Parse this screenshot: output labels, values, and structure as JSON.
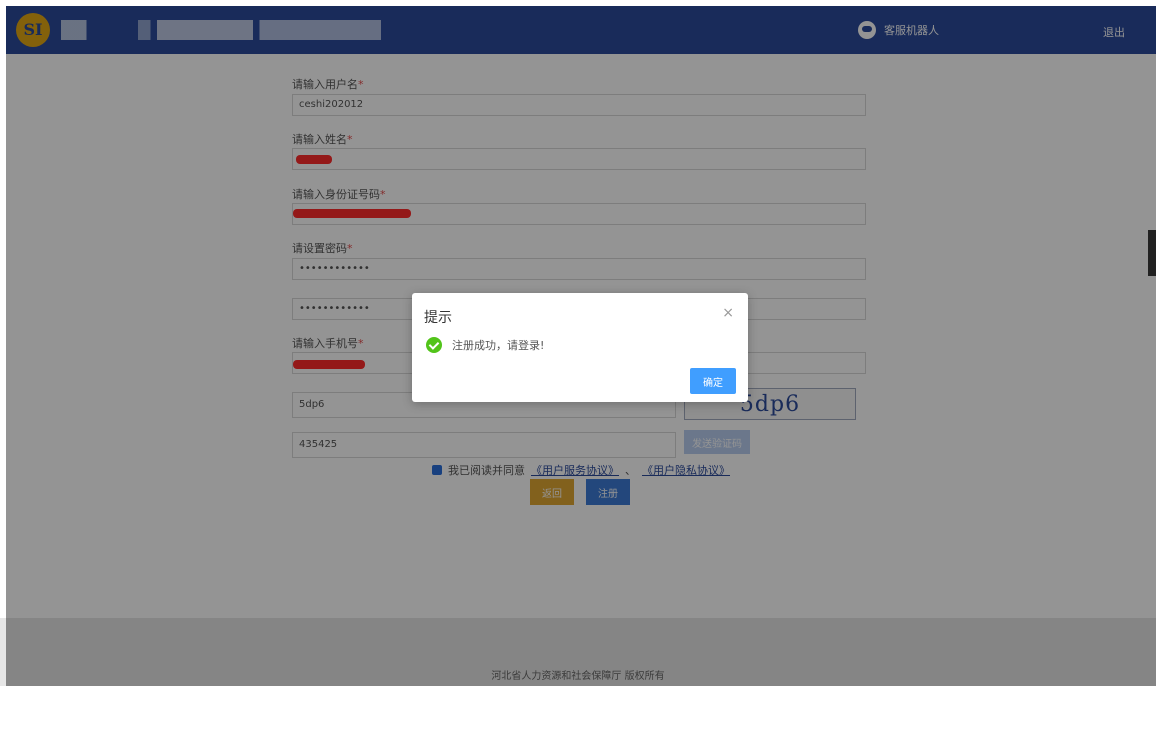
{
  "header": {
    "logo_text": "SI",
    "robot_label": "客服机器人",
    "exit_label": "退出"
  },
  "form": {
    "username_label": "请输入用户名",
    "username_value": "ceshi202012",
    "name_label": "请输入姓名",
    "id_label": "请输入身份证号码",
    "password_label": "请设置密码",
    "password_value": "••••••••••••",
    "confirm_value": "••••••••••••",
    "phone_label": "请输入手机号",
    "captcha_value": "5dp6",
    "captcha_image_text": "5dp6",
    "sms_code_value": "435425",
    "send_code_label": "发送验证码",
    "agree_prefix": "我已阅读并同意",
    "service_agreement": "《用户服务协议》",
    "separator": "、",
    "privacy_agreement": "《用户隐私协议》",
    "return_label": "返回",
    "register_label": "注册"
  },
  "footer": {
    "text": "河北省人力资源和社会保障厅  版权所有"
  },
  "modal": {
    "title": "提示",
    "close": "×",
    "message": "注册成功，请登录!",
    "confirm": "确定"
  },
  "colors": {
    "header_bg": "#2b4a9b",
    "primary": "#409eff",
    "success": "#52c41a",
    "required": "#e24b4b",
    "return_btn": "#e0a733"
  }
}
